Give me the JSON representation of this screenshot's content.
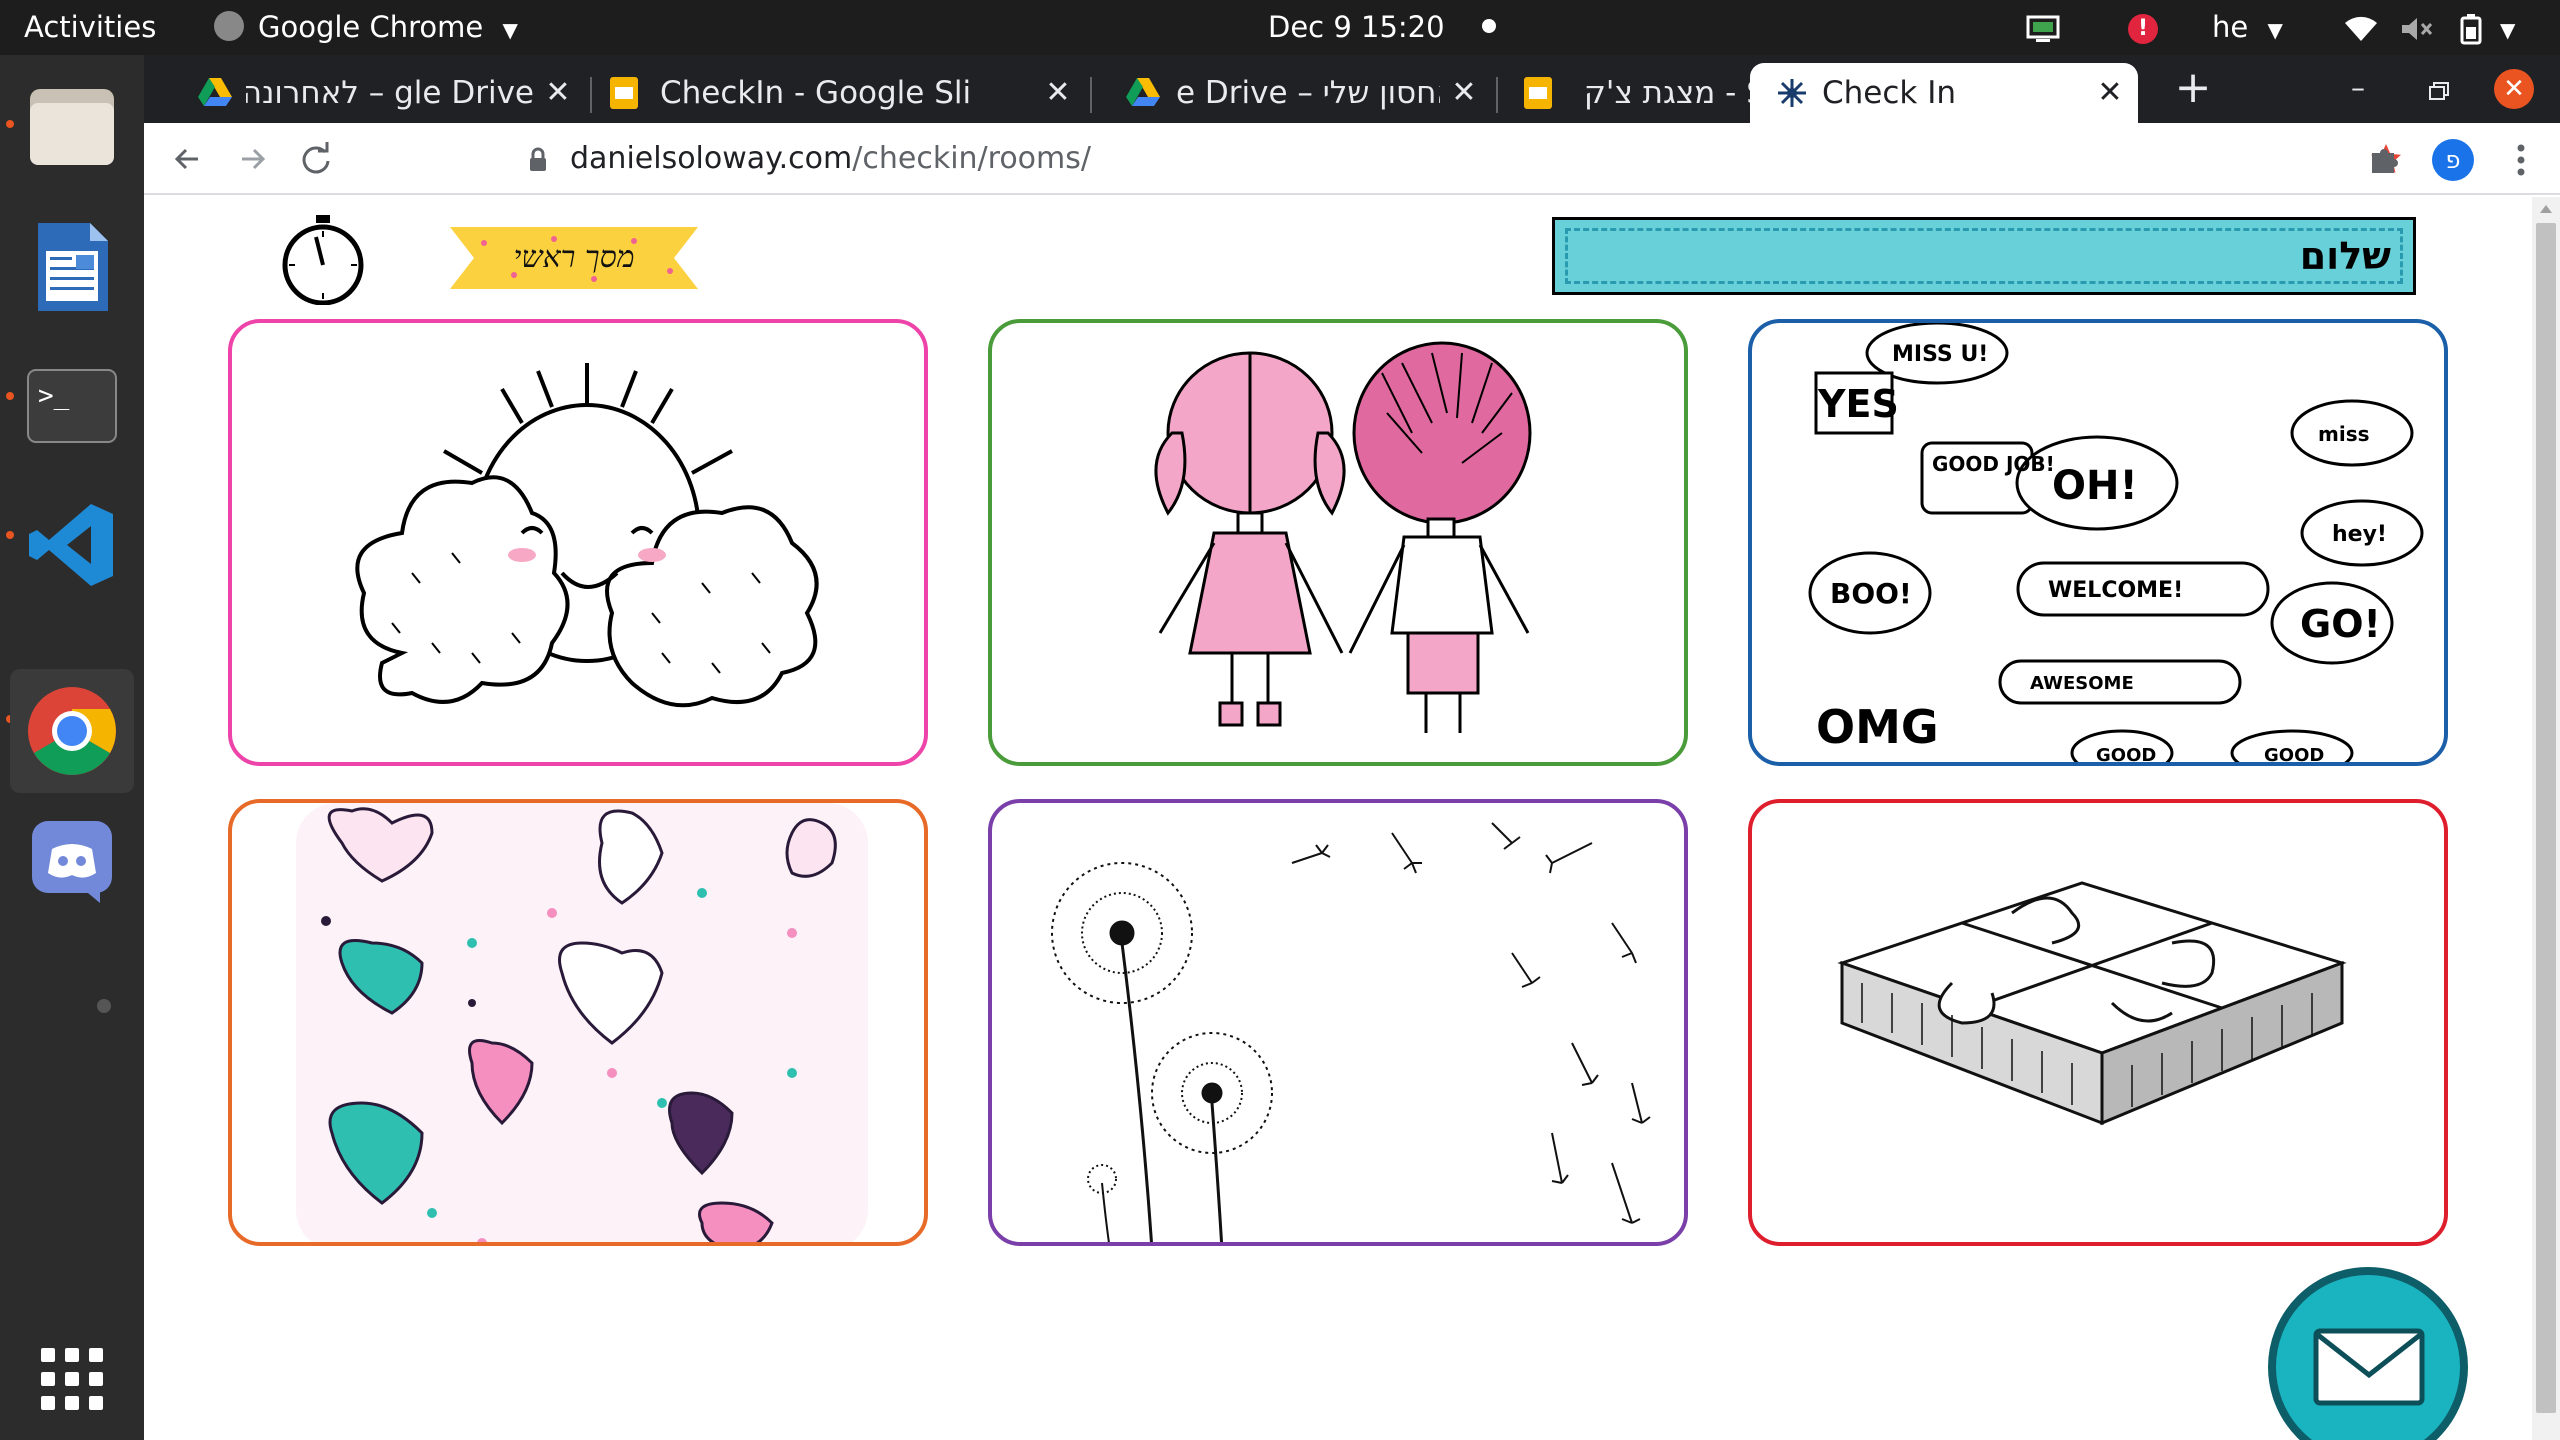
{
  "topbar": {
    "activities": "Activities",
    "app_name": "Google Chrome",
    "datetime": "Dec 9  15:20",
    "language": "he"
  },
  "browser": {
    "tabs": [
      {
        "title": "gle Drive – לאחרונה",
        "icon": "google-drive-icon"
      },
      {
        "title": "CheckIn - Google Sli",
        "icon": "google-slides-icon"
      },
      {
        "title": "e Drive – האחסון שלי",
        "icon": "google-drive-icon"
      },
      {
        "title": "Slides - מצגת צ'ק אין",
        "icon": "google-slides-icon"
      },
      {
        "title": "Check In",
        "icon": "check-in-favicon",
        "active": true
      }
    ],
    "url_domain": "danielsoloway.com",
    "url_path": "/checkin/rooms/",
    "profile_initial": "פ"
  },
  "page": {
    "greeting": "שלום",
    "fullscreen_banner": "מסך ראשי",
    "accent_colors": {
      "greeting_box": "#67d0d8",
      "banner": "#fcd13f",
      "mail_button": "#1ab4c0"
    },
    "cards": [
      {
        "name": "sun-clouds",
        "color": "#ee44aa"
      },
      {
        "name": "kids-holding-hands",
        "color": "#4a9c3a"
      },
      {
        "name": "speech-bubbles",
        "color": "#1a5fa8"
      },
      {
        "name": "hearts",
        "color": "#e86a28"
      },
      {
        "name": "dandelions",
        "color": "#7a3fa8"
      },
      {
        "name": "puzzle",
        "color": "#de1e2c"
      }
    ],
    "bubbles": {
      "b1": "MISS U!",
      "b2": "YES",
      "b3": "GOOD JOB!",
      "b4": "OH!",
      "b5": "miss",
      "b6": "hey!",
      "b7": "BOO!",
      "b8": "WELCOME!",
      "b9": "GO!",
      "b10": "OMG",
      "b11": "AWESOME",
      "b12": "GOOD",
      "b13": "GOOD"
    }
  }
}
